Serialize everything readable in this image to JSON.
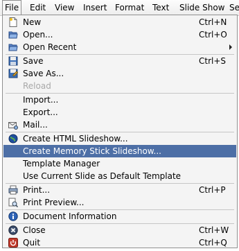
{
  "menubar": {
    "items": [
      {
        "label": "File"
      },
      {
        "label": "Edit"
      },
      {
        "label": "View"
      },
      {
        "label": "Insert"
      },
      {
        "label": "Format"
      },
      {
        "label": "Text"
      },
      {
        "label": "Slide Show"
      },
      {
        "label": "Se"
      }
    ]
  },
  "file_menu": {
    "items": [
      {
        "label": "New",
        "shortcut": "Ctrl+N",
        "icon": "new-document-icon"
      },
      {
        "label": "Open...",
        "shortcut": "Ctrl+O",
        "icon": "open-folder-icon"
      },
      {
        "label": "Open Recent",
        "submenu": true,
        "icon": "open-recent-icon"
      },
      {
        "label": "Save",
        "shortcut": "Ctrl+S",
        "icon": "save-icon"
      },
      {
        "label": "Save As...",
        "icon": "save-as-icon"
      },
      {
        "label": "Reload",
        "disabled": true
      },
      {
        "label": "Import..."
      },
      {
        "label": "Export..."
      },
      {
        "label": "Mail...",
        "icon": "mail-icon"
      },
      {
        "label": "Create HTML Slideshow...",
        "icon": "globe-icon"
      },
      {
        "label": "Create Memory Stick Slideshow...",
        "highlighted": true
      },
      {
        "label": "Template Manager"
      },
      {
        "label": "Use Current Slide as Default Template"
      },
      {
        "label": "Print...",
        "shortcut": "Ctrl+P",
        "icon": "print-icon"
      },
      {
        "label": "Print Preview...",
        "icon": "print-preview-icon"
      },
      {
        "label": "Document Information",
        "icon": "info-icon"
      },
      {
        "label": "Close",
        "shortcut": "Ctrl+W",
        "icon": "close-icon"
      },
      {
        "label": "Quit",
        "shortcut": "Ctrl+Q",
        "icon": "quit-icon"
      }
    ]
  },
  "colors": {
    "highlight": "#4d6fa6",
    "disabled_text": "#a8a8a8"
  }
}
